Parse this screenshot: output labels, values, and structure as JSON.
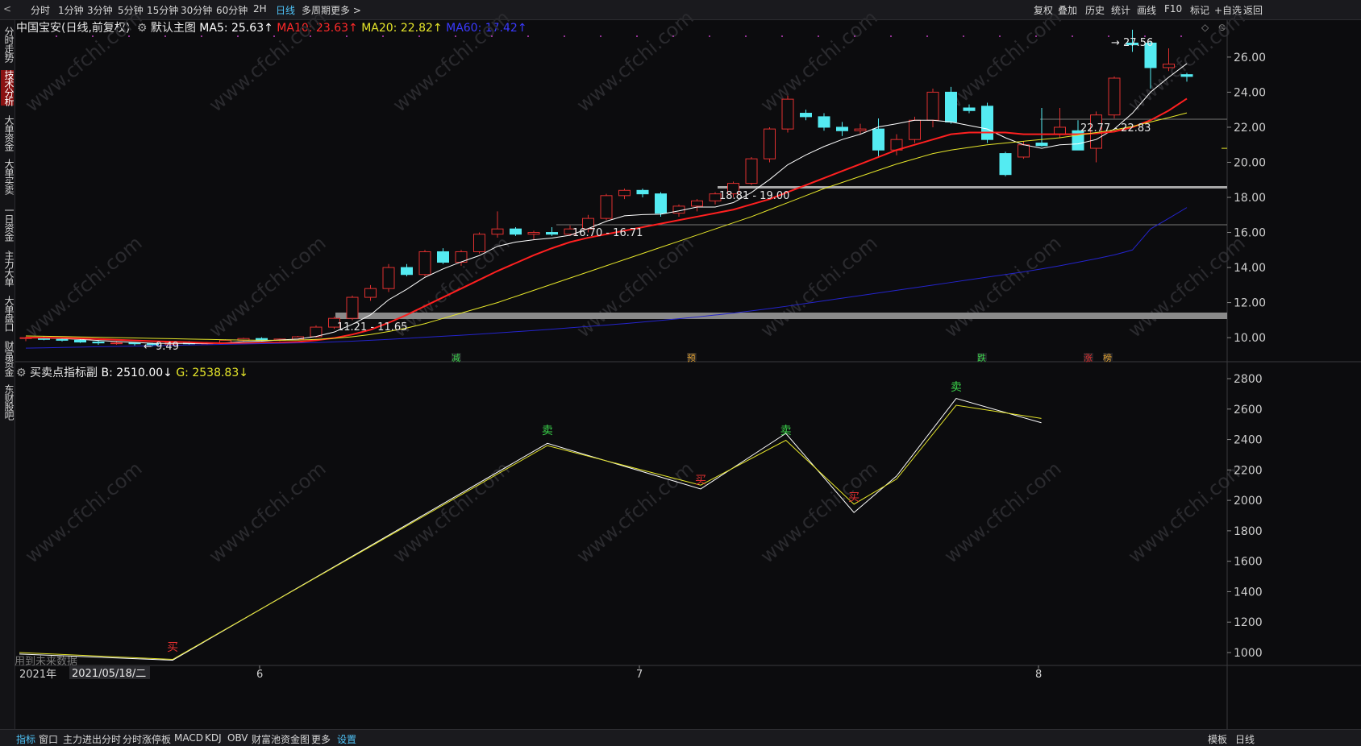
{
  "toolbar": {
    "periods": [
      "分时",
      "1分钟",
      "3分钟",
      "5分钟",
      "15分钟",
      "30分钟",
      "60分钟",
      "2H",
      "日线",
      "多周期",
      "更多 >"
    ],
    "active_period": "日线",
    "right_tools": [
      "复权",
      "叠加",
      "历史",
      "统计",
      "画线",
      "F10",
      "标记",
      "+自选",
      "返回"
    ]
  },
  "sidebar": {
    "items": [
      "分时走势",
      "技术分析",
      "大单资金",
      "大单买卖",
      "一日资金",
      "主力大单",
      "大单盘口",
      "财富资金",
      "东财股吧"
    ],
    "active": "技术分析"
  },
  "main_legend": {
    "stock": "中国宝安(日线,前复权)",
    "template": "默认主图",
    "ma5": "MA5: 25.63↑",
    "ma10": "MA10: 23.63↑",
    "ma20": "MA20: 22.82↑",
    "ma60": "MA60: 17.42↑"
  },
  "sub_legend": {
    "name": "买卖点指标副",
    "b": "B: 2510.00↓",
    "g": "G: 2538.83↓"
  },
  "price_labels": {
    "high": "27.56",
    "range1": "22.77 - 22.83",
    "range2": "18.81 - 19.00",
    "range3": "16.70 - 16.71",
    "range4": "11.21 - 11.65",
    "low": "9.49"
  },
  "event_markers": [
    "减",
    "预",
    "跌",
    "涨",
    "榜"
  ],
  "x_axis": {
    "year": "2021年",
    "date": "2021/05/18/二",
    "months": [
      "6",
      "7",
      "8"
    ]
  },
  "sub_note": "用到未来数据",
  "bottom_tabs": [
    "指标",
    "窗口",
    "主力进出分时",
    "分时涨停板",
    "MACD",
    "KDJ",
    "OBV",
    "财富池资金图",
    "更多",
    "设置"
  ],
  "bottom_right": [
    "模板",
    "日线"
  ],
  "watermark": "www.cfchi.com",
  "colors": {
    "up": "#e03030",
    "down": "#54ebf2",
    "ma5": "#ffffff",
    "ma10": "#ff2020",
    "ma20": "#e6e62a",
    "ma60": "#2424cc",
    "bg": "#0c0c0e"
  },
  "chart_data": [
    {
      "type": "candlestick",
      "title": "中国宝安(日线,前复权)",
      "ylim": [
        9,
        27.5
      ],
      "yticks": [
        "26.00",
        "24.00",
        "22.00",
        "20.00",
        "18.00",
        "16.00",
        "14.00",
        "12.00",
        "10.00"
      ],
      "ohlc": [
        [
          9.95,
          10.05,
          9.8,
          10.0
        ],
        [
          10.0,
          10.1,
          9.85,
          9.9
        ],
        [
          9.9,
          9.95,
          9.78,
          9.85
        ],
        [
          9.85,
          9.92,
          9.7,
          9.75
        ],
        [
          9.75,
          9.85,
          9.6,
          9.7
        ],
        [
          9.7,
          9.8,
          9.6,
          9.7
        ],
        [
          9.7,
          9.75,
          9.55,
          9.65
        ],
        [
          9.65,
          9.7,
          9.49,
          9.6
        ],
        [
          9.6,
          9.75,
          9.55,
          9.72
        ],
        [
          9.72,
          9.8,
          9.6,
          9.65
        ],
        [
          9.65,
          9.75,
          9.6,
          9.7
        ],
        [
          9.7,
          9.9,
          9.65,
          9.85
        ],
        [
          9.85,
          10.0,
          9.8,
          9.95
        ],
        [
          9.95,
          10.02,
          9.8,
          9.85
        ],
        [
          9.85,
          9.95,
          9.8,
          9.92
        ],
        [
          9.92,
          10.1,
          9.88,
          10.05
        ],
        [
          10.05,
          10.7,
          10.0,
          10.6
        ],
        [
          10.6,
          11.2,
          10.5,
          11.1
        ],
        [
          11.1,
          12.4,
          11.0,
          12.3
        ],
        [
          12.3,
          13.0,
          12.1,
          12.8
        ],
        [
          12.8,
          14.2,
          12.6,
          14.0
        ],
        [
          14.0,
          14.2,
          13.5,
          13.6
        ],
        [
          13.6,
          15.0,
          13.5,
          14.9
        ],
        [
          14.9,
          15.1,
          14.2,
          14.3
        ],
        [
          14.3,
          15.0,
          14.1,
          14.9
        ],
        [
          14.9,
          16.0,
          14.8,
          15.9
        ],
        [
          15.9,
          17.2,
          15.7,
          16.2
        ],
        [
          16.2,
          16.3,
          15.8,
          15.9
        ],
        [
          15.9,
          16.1,
          15.6,
          16.0
        ],
        [
          16.0,
          16.3,
          15.8,
          15.9
        ],
        [
          15.9,
          16.4,
          15.8,
          16.2
        ],
        [
          16.2,
          17.0,
          16.0,
          16.8
        ],
        [
          16.8,
          18.2,
          16.7,
          18.1
        ],
        [
          18.1,
          18.5,
          17.9,
          18.4
        ],
        [
          18.4,
          18.5,
          18.0,
          18.2
        ],
        [
          18.2,
          18.3,
          16.9,
          17.1
        ],
        [
          17.1,
          17.6,
          16.9,
          17.5
        ],
        [
          17.5,
          17.9,
          17.2,
          17.8
        ],
        [
          17.8,
          18.3,
          17.6,
          18.2
        ],
        [
          18.2,
          18.9,
          18.0,
          18.8
        ],
        [
          18.8,
          20.3,
          18.7,
          20.2
        ],
        [
          20.2,
          22.0,
          20.0,
          21.9
        ],
        [
          21.9,
          23.8,
          21.7,
          23.6
        ],
        [
          22.8,
          23.0,
          22.4,
          22.6
        ],
        [
          22.6,
          22.8,
          21.8,
          22.0
        ],
        [
          22.0,
          22.3,
          21.5,
          21.8
        ],
        [
          21.8,
          22.2,
          21.6,
          21.9
        ],
        [
          21.9,
          22.5,
          20.3,
          20.7
        ],
        [
          20.7,
          21.6,
          20.4,
          21.3
        ],
        [
          21.3,
          22.6,
          21.1,
          22.4
        ],
        [
          22.4,
          24.2,
          22.0,
          24.0
        ],
        [
          24.0,
          24.3,
          22.2,
          22.3
        ],
        [
          23.1,
          23.3,
          22.8,
          22.95
        ],
        [
          23.2,
          23.4,
          21.1,
          21.3
        ],
        [
          20.5,
          20.6,
          19.2,
          19.3
        ],
        [
          20.3,
          21.2,
          20.2,
          21.0
        ],
        [
          21.1,
          23.1,
          20.9,
          20.95
        ],
        [
          21.6,
          23.1,
          21.4,
          22.0
        ],
        [
          21.8,
          22.4,
          20.9,
          20.7
        ],
        [
          20.8,
          22.9,
          20.0,
          22.7
        ],
        [
          22.7,
          24.9,
          22.5,
          24.8
        ],
        [
          26.8,
          27.56,
          26.3,
          26.7
        ],
        [
          26.8,
          26.9,
          24.2,
          25.4
        ],
        [
          25.4,
          26.5,
          25.2,
          25.6
        ],
        [
          25.0,
          25.1,
          24.6,
          24.9
        ]
      ],
      "ma_series": [
        {
          "name": "MA5",
          "color": "#ffffff",
          "values": [
            10.0,
            9.98,
            9.95,
            9.9,
            9.84,
            9.78,
            9.73,
            9.68,
            9.67,
            9.67,
            9.66,
            9.7,
            9.77,
            9.8,
            9.87,
            9.92,
            10.07,
            10.32,
            10.76,
            11.3,
            12.16,
            12.76,
            13.44,
            13.92,
            14.32,
            14.68,
            15.21,
            15.45,
            15.58,
            15.68,
            15.84,
            16.22,
            16.64,
            16.95,
            17.02,
            17.04,
            17.23,
            17.45,
            17.45,
            17.7,
            18.28,
            19.02,
            19.86,
            20.42,
            20.9,
            21.3,
            21.6,
            22.02,
            22.2,
            22.4,
            22.4,
            22.3,
            22.1,
            21.9,
            21.4,
            21.0,
            20.8,
            21.0,
            21.05,
            21.3,
            21.9,
            22.8,
            24.0,
            24.85,
            25.63
          ]
        },
        {
          "name": "MA10",
          "color": "#ff2020",
          "values": [
            10.0,
            10.0,
            9.99,
            9.96,
            9.92,
            9.88,
            9.84,
            9.8,
            9.77,
            9.74,
            9.7,
            9.68,
            9.68,
            9.7,
            9.72,
            9.76,
            9.85,
            9.98,
            10.18,
            10.45,
            10.85,
            11.3,
            11.8,
            12.3,
            12.8,
            13.3,
            13.8,
            14.25,
            14.7,
            15.1,
            15.45,
            15.7,
            15.9,
            16.1,
            16.3,
            16.5,
            16.7,
            16.9,
            17.1,
            17.3,
            17.6,
            17.9,
            18.3,
            18.7,
            19.1,
            19.5,
            19.9,
            20.3,
            20.7,
            21.0,
            21.3,
            21.6,
            21.7,
            21.7,
            21.7,
            21.6,
            21.6,
            21.6,
            21.6,
            21.65,
            21.75,
            22.0,
            22.4,
            22.95,
            23.63
          ]
        },
        {
          "name": "MA20",
          "color": "#e6e62a",
          "values": [
            10.1,
            10.08,
            10.06,
            10.04,
            10.02,
            10.0,
            9.98,
            9.96,
            9.94,
            9.92,
            9.9,
            9.88,
            9.86,
            9.85,
            9.85,
            9.86,
            9.9,
            9.96,
            10.05,
            10.18,
            10.35,
            10.55,
            10.8,
            11.1,
            11.4,
            11.7,
            12.0,
            12.35,
            12.7,
            13.05,
            13.4,
            13.75,
            14.1,
            14.45,
            14.8,
            15.15,
            15.5,
            15.85,
            16.2,
            16.55,
            16.9,
            17.3,
            17.7,
            18.1,
            18.5,
            18.85,
            19.2,
            19.55,
            19.9,
            20.2,
            20.5,
            20.7,
            20.85,
            21.0,
            21.1,
            21.2,
            21.3,
            21.4,
            21.55,
            21.7,
            21.85,
            22.05,
            22.3,
            22.55,
            22.82
          ]
        },
        {
          "name": "MA60",
          "color": "#2424cc",
          "values": [
            9.4,
            9.42,
            9.44,
            9.46,
            9.48,
            9.5,
            9.52,
            9.54,
            9.56,
            9.58,
            9.6,
            9.62,
            9.64,
            9.66,
            9.68,
            9.7,
            9.72,
            9.76,
            9.8,
            9.85,
            9.9,
            9.96,
            10.02,
            10.08,
            10.14,
            10.2,
            10.27,
            10.34,
            10.41,
            10.48,
            10.56,
            10.64,
            10.72,
            10.8,
            10.89,
            10.98,
            11.08,
            11.18,
            11.29,
            11.4,
            11.53,
            11.66,
            11.8,
            11.95,
            12.1,
            12.25,
            12.4,
            12.55,
            12.7,
            12.85,
            13.0,
            13.15,
            13.3,
            13.45,
            13.6,
            13.75,
            13.92,
            14.1,
            14.3,
            14.5,
            14.72,
            15.0,
            16.2,
            16.8,
            17.42
          ]
        }
      ]
    },
    {
      "type": "line",
      "title": "买卖点指标副",
      "ylim": [
        900,
        2850
      ],
      "yticks": [
        "2800",
        "2600",
        "2400",
        "2200",
        "2000",
        "1800",
        "1600",
        "1400",
        "1200",
        "1000"
      ],
      "x_index": [
        0,
        18,
        62,
        80,
        90,
        98,
        103,
        110,
        120,
        128,
        135
      ],
      "series": [
        {
          "name": "B",
          "color": "#ffffff",
          "values": [
            990,
            950,
            2375,
            2075,
            2440,
            1920,
            2160,
            2670,
            2510
          ]
        },
        {
          "name": "G",
          "color": "#e6e62a",
          "values": [
            1000,
            955,
            2360,
            2100,
            2395,
            1975,
            2140,
            2625,
            2538.83
          ]
        }
      ],
      "signals": [
        {
          "label": "买",
          "color": "#e03030",
          "x": 18,
          "y": 1010
        },
        {
          "label": "卖",
          "color": "#3ad24a",
          "x": 62,
          "y": 2435
        },
        {
          "label": "买",
          "color": "#e03030",
          "x": 80,
          "y": 2110
        },
        {
          "label": "卖",
          "color": "#3ad24a",
          "x": 90,
          "y": 2435
        },
        {
          "label": "买",
          "color": "#e03030",
          "x": 98,
          "y": 1995
        },
        {
          "label": "卖",
          "color": "#3ad24a",
          "x": 110,
          "y": 2720
        }
      ]
    }
  ]
}
